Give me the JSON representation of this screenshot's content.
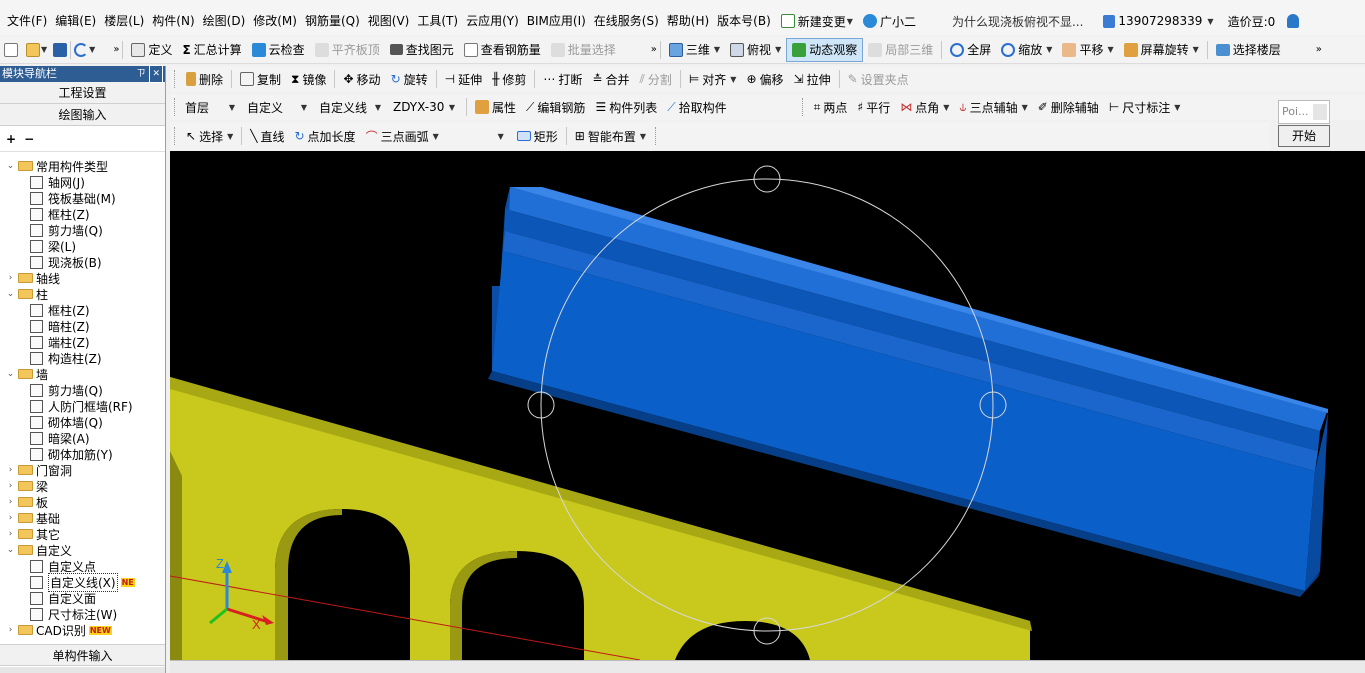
{
  "menu": {
    "items": [
      "文件(F)",
      "编辑(E)",
      "楼层(L)",
      "构件(N)",
      "绘图(D)",
      "修改(M)",
      "钢筋量(Q)",
      "视图(V)",
      "工具(T)",
      "云应用(Y)",
      "BIM应用(I)",
      "在线服务(S)",
      "帮助(H)",
      "版本号(B)"
    ],
    "new_change": "新建变更",
    "assistant": "广小二",
    "question": "为什么现浇板俯视不显...",
    "phone": "13907298339",
    "beans": "造价豆:0"
  },
  "toolbar1": {
    "define": "定义",
    "sum": "汇总计算",
    "cloud_check": "云检查",
    "flush_slab": "平齐板顶",
    "find": "查找图元",
    "view_rebar": "查看钢筋量",
    "batch_select": "批量选择",
    "three_d": "三维",
    "top_view": "俯视",
    "dynamic": "动态观察",
    "local_3d": "局部三维",
    "fullscreen": "全屏",
    "zoom": "缩放",
    "pan": "平移",
    "rotate_screen": "屏幕旋转",
    "select_floor": "选择楼层"
  },
  "toolbar2": {
    "delete": "删除",
    "copy": "复制",
    "mirror": "镜像",
    "move": "移动",
    "rotate": "旋转",
    "extend": "延伸",
    "trim": "修剪",
    "break": "打断",
    "merge": "合并",
    "split": "分割",
    "align": "对齐",
    "offset": "偏移",
    "stretch": "拉伸",
    "set_grip": "设置夹点"
  },
  "toolbar3": {
    "floor": "首层",
    "custom": "自定义",
    "custom_line": "自定义线",
    "component": "ZDYX-30",
    "property": "属性",
    "edit_rebar": "编辑钢筋",
    "component_list": "构件列表",
    "pick": "拾取构件",
    "two_points": "两点",
    "parallel": "平行",
    "point_angle": "点角",
    "three_axis": "三点辅轴",
    "del_axis": "删除辅轴",
    "dim": "尺寸标注"
  },
  "toolbar4": {
    "select": "选择",
    "line": "直线",
    "point_length": "点加长度",
    "arc": "三点画弧",
    "rect": "矩形",
    "smart": "智能布置"
  },
  "float_box": {
    "placeholder": "Poi...",
    "start": "开始"
  },
  "panel": {
    "title": "模块导航栏",
    "pin": "ㄗ",
    "close": "✕",
    "project_settings": "工程设置",
    "draw_input": "绘图输入",
    "single_input": "单构件输入",
    "tree": [
      {
        "level": 0,
        "label": "常用构件类型",
        "type": "folder",
        "open": true
      },
      {
        "level": 1,
        "label": "轴网(J)",
        "type": "leaf"
      },
      {
        "level": 1,
        "label": "筏板基础(M)",
        "type": "leaf"
      },
      {
        "level": 1,
        "label": "框柱(Z)",
        "type": "leaf"
      },
      {
        "level": 1,
        "label": "剪力墙(Q)",
        "type": "leaf"
      },
      {
        "level": 1,
        "label": "梁(L)",
        "type": "leaf"
      },
      {
        "level": 1,
        "label": "现浇板(B)",
        "type": "leaf"
      },
      {
        "level": 0,
        "label": "轴线",
        "type": "folder",
        "open": false
      },
      {
        "level": 0,
        "label": "柱",
        "type": "folder",
        "open": true
      },
      {
        "level": 1,
        "label": "框柱(Z)",
        "type": "leaf"
      },
      {
        "level": 1,
        "label": "暗柱(Z)",
        "type": "leaf"
      },
      {
        "level": 1,
        "label": "端柱(Z)",
        "type": "leaf"
      },
      {
        "level": 1,
        "label": "构造柱(Z)",
        "type": "leaf"
      },
      {
        "level": 0,
        "label": "墙",
        "type": "folder",
        "open": true
      },
      {
        "level": 1,
        "label": "剪力墙(Q)",
        "type": "leaf"
      },
      {
        "level": 1,
        "label": "人防门框墙(RF)",
        "type": "leaf"
      },
      {
        "level": 1,
        "label": "砌体墙(Q)",
        "type": "leaf"
      },
      {
        "level": 1,
        "label": "暗梁(A)",
        "type": "leaf"
      },
      {
        "level": 1,
        "label": "砌体加筋(Y)",
        "type": "leaf"
      },
      {
        "level": 0,
        "label": "门窗洞",
        "type": "folder",
        "open": false
      },
      {
        "level": 0,
        "label": "梁",
        "type": "folder",
        "open": false
      },
      {
        "level": 0,
        "label": "板",
        "type": "folder",
        "open": false
      },
      {
        "level": 0,
        "label": "基础",
        "type": "folder",
        "open": false
      },
      {
        "level": 0,
        "label": "其它",
        "type": "folder",
        "open": false
      },
      {
        "level": 0,
        "label": "自定义",
        "type": "folder",
        "open": true
      },
      {
        "level": 1,
        "label": "自定义点",
        "type": "leaf"
      },
      {
        "level": 1,
        "label": "自定义线(X)",
        "type": "leaf",
        "selected": true,
        "badge": "NE"
      },
      {
        "level": 1,
        "label": "自定义面",
        "type": "leaf"
      },
      {
        "level": 1,
        "label": "尺寸标注(W)",
        "type": "leaf"
      },
      {
        "level": 0,
        "label": "CAD识别",
        "type": "folder",
        "open": false,
        "badge": "NEW"
      }
    ]
  },
  "axes": {
    "z": "Z",
    "x": "X"
  },
  "colors": {
    "beam": "#0a5fc9",
    "slab": "#c7c71e",
    "viewport": "#000000",
    "panel_title": "#2e5d94"
  }
}
